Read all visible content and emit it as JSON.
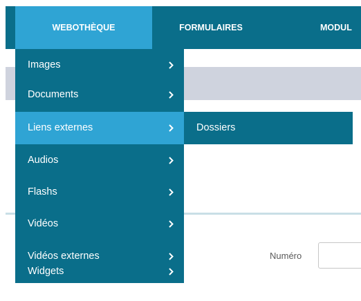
{
  "nav": {
    "items": [
      {
        "label": "WEBOTHÈQUE",
        "active": true
      },
      {
        "label": "FORMULAIRES",
        "active": false
      },
      {
        "label": "MODUL",
        "active": false
      }
    ]
  },
  "dropdown": {
    "items": [
      {
        "label": "Images",
        "icon": "chevron-right-icon"
      },
      {
        "label": "Documents",
        "icon": "chevron-right-icon"
      },
      {
        "label": "Liens externes",
        "icon": "chevron-right-icon",
        "active": true
      },
      {
        "label": "Audios",
        "icon": "chevron-right-icon"
      },
      {
        "label": "Flashs",
        "icon": "chevron-right-icon"
      },
      {
        "label": "Vidéos",
        "icon": "chevron-right-icon"
      },
      {
        "label": "Vidéos externes",
        "icon": "chevron-right-icon"
      },
      {
        "label": "Widgets",
        "icon": "chevron-right-icon"
      }
    ]
  },
  "submenu": {
    "items": [
      {
        "label": "Dossiers"
      }
    ]
  },
  "form": {
    "numero_label": "Numéro",
    "numero_value": ""
  },
  "colors": {
    "nav_background": "#0a6e8a",
    "active_background": "#2fa4d4",
    "band_background": "#cfd3de",
    "text_on_dark": "#ffffff"
  }
}
